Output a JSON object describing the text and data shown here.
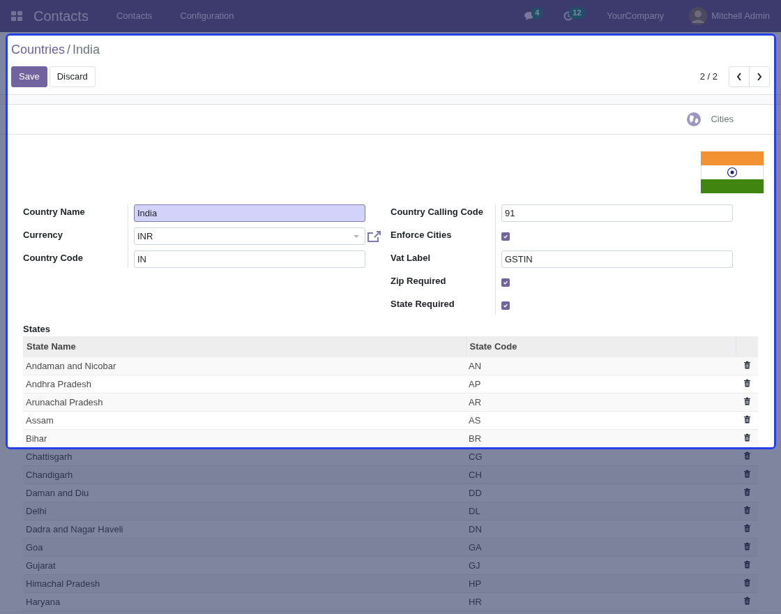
{
  "navbar": {
    "app_name": "Contacts",
    "menu": [
      "Contacts",
      "Configuration"
    ],
    "messages_count": "4",
    "activities_count": "12",
    "company": "YourCompany",
    "user": "Mitchell Admin"
  },
  "breadcrumbs": [
    {
      "label": "Countries",
      "kind": "link"
    },
    {
      "label": "India",
      "kind": "current"
    }
  ],
  "breadcrumb_separator": "/",
  "actions": [
    {
      "label": "Save",
      "kind": "primary"
    },
    {
      "label": "Discard",
      "kind": "secondary"
    }
  ],
  "pager": "2 / 2",
  "smart_button": "Cities",
  "left_fields": [
    {
      "label": "Country Name",
      "kind": "text",
      "value": "India",
      "focused": true
    },
    {
      "label": "Currency",
      "kind": "select",
      "value": "INR",
      "focused": false
    },
    {
      "label": "Country Code",
      "kind": "text",
      "value": "IN",
      "focused": false
    }
  ],
  "right_fields": [
    {
      "label": "Country Calling Code",
      "kind": "text",
      "value": "91"
    },
    {
      "label": "Enforce Cities",
      "kind": "checkbox",
      "checked": true
    },
    {
      "label": "Vat Label",
      "kind": "text",
      "value": "GSTIN"
    },
    {
      "label": "Zip Required",
      "kind": "checkbox",
      "checked": true
    },
    {
      "label": "State Required",
      "kind": "checkbox",
      "checked": true
    }
  ],
  "states": {
    "title": "States",
    "columns": [
      "State Name",
      "State Code"
    ],
    "rows": [
      [
        "Andaman and Nicobar",
        "AN"
      ],
      [
        "Andhra Pradesh",
        "AP"
      ],
      [
        "Arunachal Pradesh",
        "AR"
      ],
      [
        "Assam",
        "AS"
      ],
      [
        "Bihar",
        "BR"
      ],
      [
        "Chattisgarh",
        "CG"
      ],
      [
        "Chandigarh",
        "CH"
      ],
      [
        "Daman and Diu",
        "DD"
      ],
      [
        "Delhi",
        "DL"
      ],
      [
        "Dadra and Nagar Haveli",
        "DN"
      ],
      [
        "Goa",
        "GA"
      ],
      [
        "Gujarat",
        "GJ"
      ],
      [
        "Himachal Pradesh",
        "HP"
      ],
      [
        "Haryana",
        "HR"
      ]
    ]
  }
}
